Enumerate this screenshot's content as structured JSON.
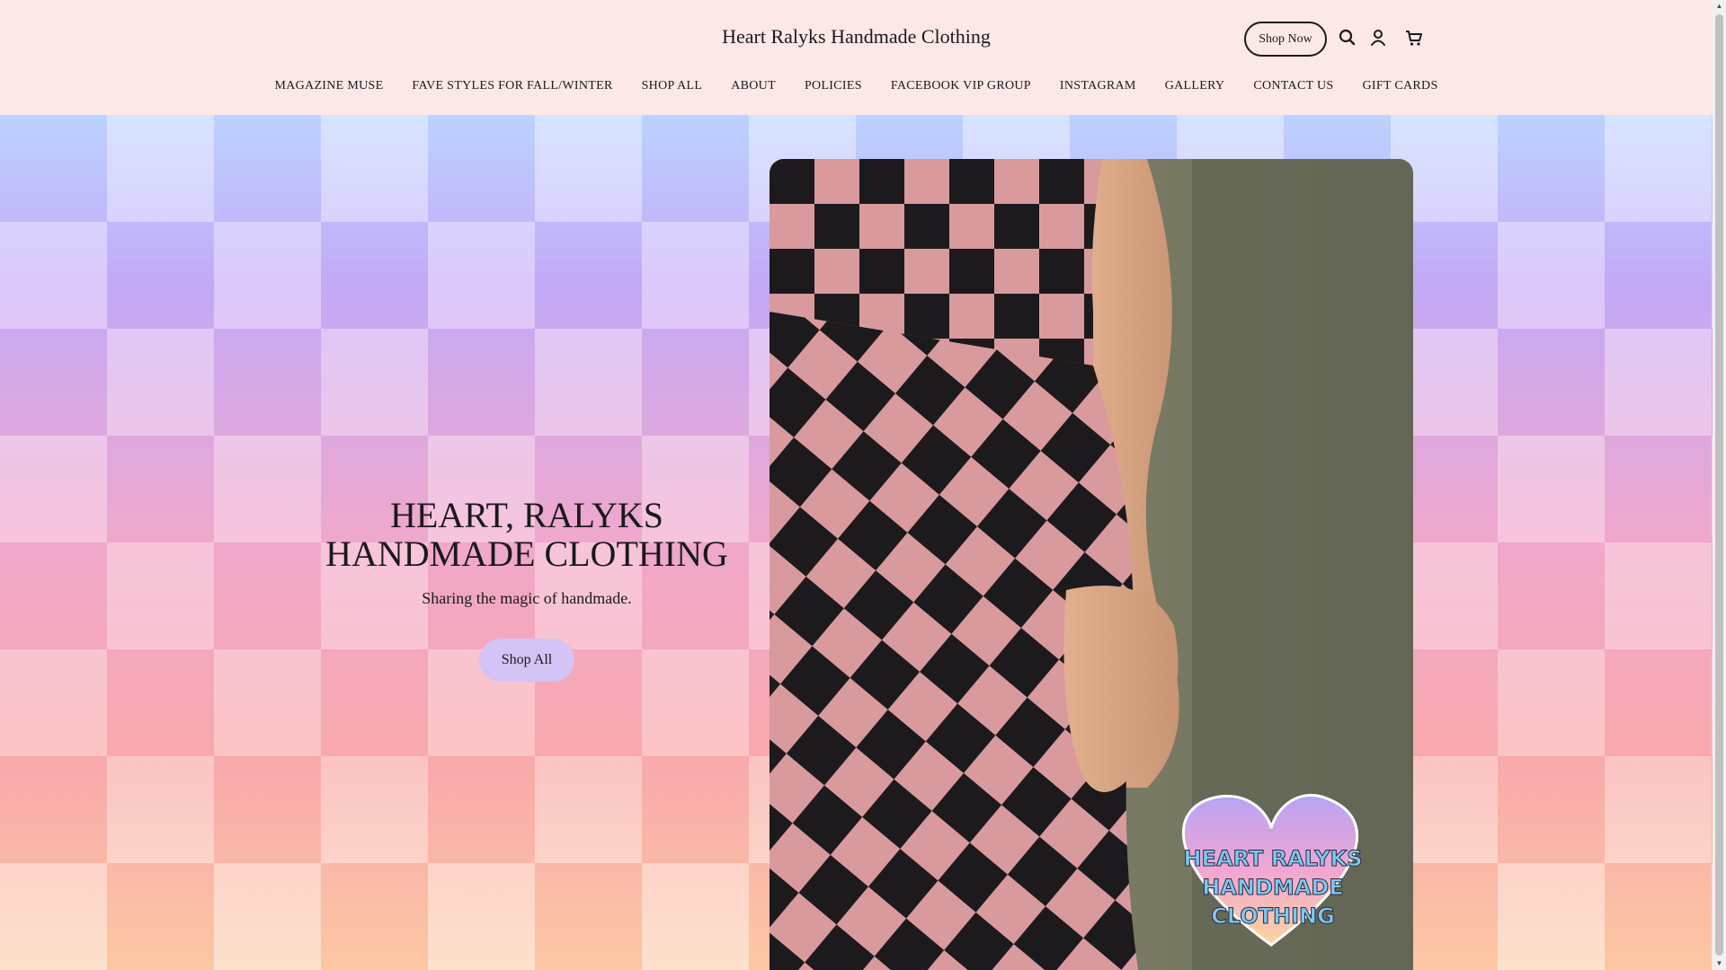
{
  "header": {
    "brand": "Heart Ralyks Handmade Clothing",
    "shop_now": "Shop Now",
    "icons": [
      "search-icon",
      "account-icon",
      "cart-icon"
    ]
  },
  "nav": {
    "items": [
      "MAGAZINE MUSE",
      "FAVE STYLES FOR FALL/WINTER",
      "SHOP ALL",
      "ABOUT",
      "POLICIES",
      "FACEBOOK VIP GROUP",
      "INSTAGRAM",
      "GALLERY",
      "CONTACT US",
      "GIFT CARDS"
    ]
  },
  "hero": {
    "title_line1": "HEART, RALYKS",
    "title_line2": "HANDMADE CLOTHING",
    "subtitle": "Sharing the magic of handmade.",
    "button": "Shop All",
    "logo_line1": "HEART RALYKS",
    "logo_line2": "HANDMADE",
    "logo_line3": "CLOTHING"
  },
  "colors": {
    "header_bg": "#fde8e8",
    "button_bg": "#d4c3f5",
    "dress_pink": "#d99a9e",
    "dress_black": "#1c1a1c"
  }
}
